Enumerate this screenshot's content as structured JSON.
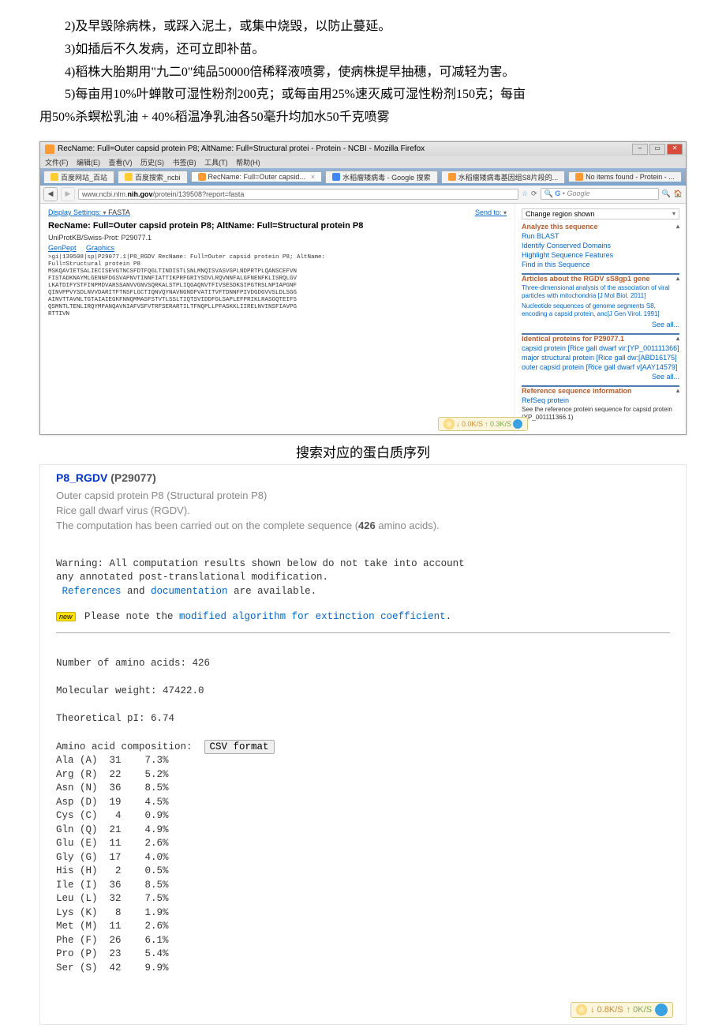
{
  "text": {
    "l1": "2)及早毁除病株，或踩入泥土，或集中烧毁，以防止蔓延。",
    "l2": "3)如插后不久发病，还可立即补苗。",
    "l3": "4)稻株大胎期用\"九二0\"纯品50000倍稀释液喷雾，使病株提早抽穗，可减轻为害。",
    "l4": "5)每亩用10%叶蝉散可湿性粉剂200克；或每亩用25%速灭威可湿性粉剂150克；每亩",
    "l5": "用50%杀螟松乳油 + 40%稻温净乳油各50毫升均加水50千克喷雾"
  },
  "browser": {
    "title": "RecName: Full=Outer capsid protein P8; AltName: Full=Structural protei - Protein - NCBI - Mozilla Firefox",
    "menus": {
      "file": "文件(F)",
      "edit": "编辑(E)",
      "view": "查看(V)",
      "hist": "历史(S)",
      "book": "书签(B)",
      "tools": "工具(T)",
      "help": "帮助(H)"
    },
    "tabs": {
      "t1": "百度网站_百站",
      "t2": "百度搜索_ncbi",
      "t3": "RecName: Full=Outer capsid...",
      "t4": "水稻瘤矮病毒 - Google 搜索",
      "t5": "水稻瘤矮病毒基因组S8片段的...",
      "t6": "No items found - Protein - ..."
    },
    "url_pre": "www.ncbi.nlm.",
    "url_dom": "nih.gov",
    "url_post": "/protein/139508?report=fasta",
    "searchph": "Google",
    "display": "Display Settings:",
    "fasta": "FASTA",
    "sendto": "Send to:",
    "heading": "RecName: Full=Outer capsid protein P8; AltName: Full=Structural protein P8",
    "uniprot": "UniProtKB/Swiss-Prot: P29077.1",
    "genpept": "GenPept",
    "graphics": "Graphics",
    "seq": ">gi|139508|sp|P29077.1|P8_RGDV RecName: Full=Outer capsid protein P8; AltName:\nFull=Structural protein P8\nMSKQAVIETSALIECISEVGTNCSFDTFQGLTINDISTLSNLMNQISVASVGPLNDPRTPLQANSCEFVN\nFISTADKNAYMLGENNFDGSVAPNVTINNFIATTIKPRFGRIYSDVLRQVNNFALGFNENFKLISRQLGV\nLKATDIFYSTFINPMDVARSSANVVGNVSQRKALSTPLIQGAQNVTFIVSESDKSIPGTRSLNPIAPGNF\nQINVPPVYSDLNVVDARITFTNSFLGCTIQNVQYNAVNGNDFVATITVFTDNNFPIVDGDGVVSLDLSGG\nAINVTTAVNLTGTAIAIEGKFNNQMMASFSTVTLSSLTIQTSVIDDFGLSAPLEFPRIKLRASGQTEIFS\nQSMNTLTENLIRQYMPANQAVNIAFVSFVTRFSERARTILTFNQPLLPFASKKLIIRELNVINSFIAVPG\nRTTIVN",
    "changereg": "Change region shown",
    "analyze": "Analyze this sequence",
    "runblast": "Run BLAST",
    "identdom": "Identify Conserved Domains",
    "highlight": "Highlight Sequence Features",
    "findseq": "Find in this Sequence",
    "articles": "Articles about the RGDV sS8gp1 gene",
    "art1": "Three-dimensional analysis of the association of viral particles with mitochondria [J Mol Biol. 2011]",
    "art2": "Nucleotide sequences of genome segments S8, encoding a capsid protein, anc[J Gen Virol. 1991]",
    "seeall": "See all...",
    "ident": "Identical proteins for P29077.1",
    "ip1": "capsid protein [Rice gall dwarf vir:[YP_001111366]",
    "ip2": "major structural protein [Rice gall dw:[ABD16175]",
    "ip3": "outer capsid protein [Rice gall dwarf v[AAY14579]",
    "refseq": "Reference sequence information",
    "refp": "RefSeq protein",
    "reft": "See the reference protein sequence for capsid protein (YP_001111366.1)",
    "speed_d": "↓ 0.0K/S",
    "speed_u": "↑ 0.3K/S"
  },
  "caption": "搜索对应的蛋白质序列",
  "pp": {
    "title": "P8_RGDV",
    "acc": "(P29077)",
    "d1": "Outer capsid protein P8 (Structural protein P8)",
    "d2": "Rice gall dwarf virus (RGDV).",
    "d3a": "The computation has been carried out on the complete sequence (",
    "d3b": "426",
    "d3c": " amino acids).",
    "warn1": "Warning: All computation results shown below do not take into account",
    "warn2": "any annotated post-translational modification.",
    "refs": "References",
    "and": " and ",
    "doc": "documentation",
    "avail": " are available.",
    "pnote": " Please note the ",
    "modalg": "modified algorithm for extinction coefficient",
    "num_aa": "Number of amino acids: 426",
    "mw": "Molecular weight: 47422.0",
    "pi": "Theoretical pI: 6.74",
    "aac": "Amino acid composition:",
    "csv": "CSV format",
    "rows": [
      "Ala (A)  31    7.3%",
      "Arg (R)  22    5.2%",
      "Asn (N)  36    8.5%",
      "Asp (D)  19    4.5%",
      "Cys (C)   4    0.9%",
      "Gln (Q)  21    4.9%",
      "Glu (E)  11    2.6%",
      "Gly (G)  17    4.0%",
      "His (H)   2    0.5%",
      "Ile (I)  36    8.5%",
      "Leu (L)  32    7.5%",
      "Lys (K)   8    1.9%",
      "Met (M)  11    2.6%",
      "Phe (F)  26    6.1%",
      "Pro (P)  23    5.4%",
      "Ser (S)  42    9.9%"
    ],
    "bspeed_d": "↓ 0.8K/S",
    "bspeed_u": "↑   0K/S"
  }
}
